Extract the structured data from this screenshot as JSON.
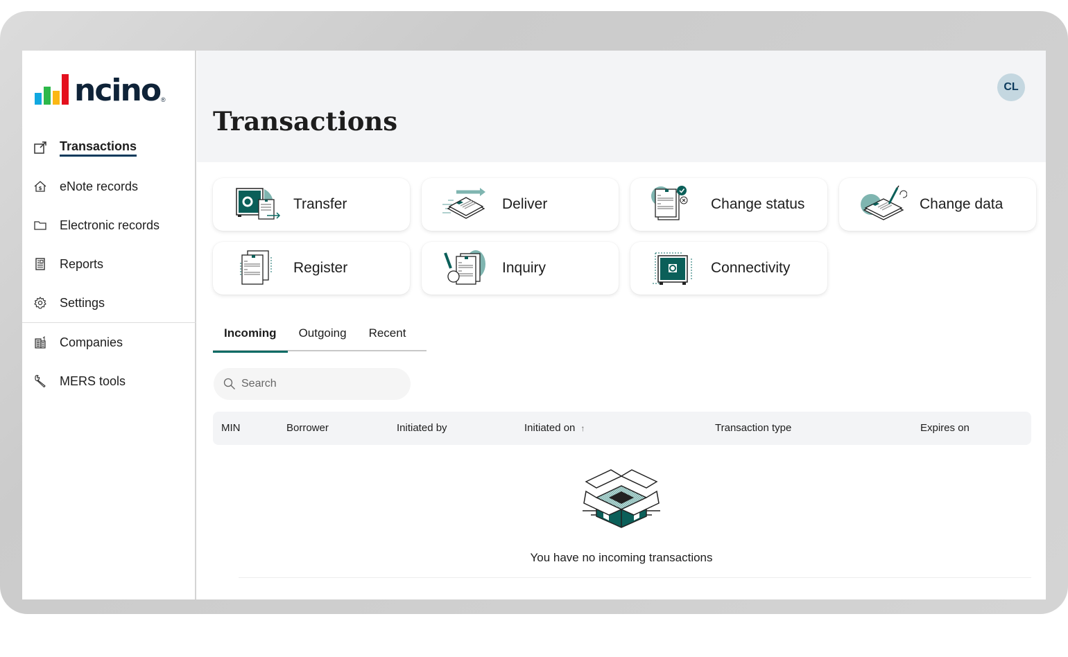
{
  "app": {
    "brand": "ncino",
    "brand_colors": [
      "#11a8e0",
      "#2db84a",
      "#fbb714",
      "#e4101e"
    ]
  },
  "sidebar": {
    "items": [
      {
        "label": "Transactions",
        "icon": "external-link-icon",
        "active": true
      },
      {
        "label": "eNote records",
        "icon": "house-dollar-icon"
      },
      {
        "label": "Electronic records",
        "icon": "folder-icon"
      },
      {
        "label": "Reports",
        "icon": "report-icon"
      },
      {
        "label": "Settings",
        "icon": "gear-icon"
      },
      {
        "label": "Companies",
        "icon": "building-icon"
      },
      {
        "label": "MERS tools",
        "icon": "wrench-icon"
      }
    ]
  },
  "header": {
    "title": "Transactions",
    "avatar_initials": "CL"
  },
  "actions": [
    {
      "label": "Transfer",
      "icon": "vault-transfer-icon"
    },
    {
      "label": "Deliver",
      "icon": "deliver-document-icon"
    },
    {
      "label": "Change status",
      "icon": "change-status-icon"
    },
    {
      "label": "Change data",
      "icon": "change-data-icon"
    },
    {
      "label": "Register",
      "icon": "register-document-icon"
    },
    {
      "label": "Inquiry",
      "icon": "inquiry-magnifier-icon"
    },
    {
      "label": "Connectivity",
      "icon": "connectivity-vault-icon"
    }
  ],
  "tabs": [
    {
      "label": "Incoming",
      "active": true
    },
    {
      "label": "Outgoing"
    },
    {
      "label": "Recent"
    }
  ],
  "search": {
    "placeholder": "Search",
    "value": ""
  },
  "table": {
    "columns": [
      "MIN",
      "Borrower",
      "Initiated by",
      "Initiated on",
      "Transaction type",
      "Expires on"
    ],
    "sorted_column": "Initiated on",
    "sort_direction": "ascending",
    "rows": []
  },
  "empty_state": {
    "message": "You have no incoming transactions",
    "icon": "open-box-icon"
  },
  "colors": {
    "accent": "#0b6b64",
    "nav_underline": "#0b3a5c",
    "avatar_bg": "#c4d7e0"
  }
}
